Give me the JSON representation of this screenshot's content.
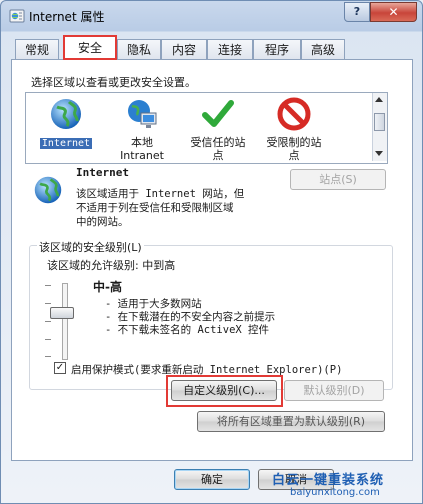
{
  "window": {
    "title": "Internet 属性",
    "help_label": "?",
    "close_label": "✕"
  },
  "tabs": [
    {
      "label": "常规"
    },
    {
      "label": "安全"
    },
    {
      "label": "隐私"
    },
    {
      "label": "内容"
    },
    {
      "label": "连接"
    },
    {
      "label": "程序"
    },
    {
      "label": "高级"
    }
  ],
  "active_tab": "安全",
  "zones_prompt": "选择区域以查看或更改安全设置。",
  "zones": [
    {
      "label": "Internet",
      "icon": "globe-icon",
      "selected": true
    },
    {
      "label": "本地\nIntranet",
      "icon": "local-intranet-icon"
    },
    {
      "label": "受信任的站\n点",
      "icon": "green-check-icon"
    },
    {
      "label": "受限制的站\n点",
      "icon": "no-entry-icon"
    }
  ],
  "zone_info": {
    "name": "Internet",
    "desc_1": "该区域适用于 Internet 网站，但",
    "desc_2": "不适用于列在受信任和受限制区域",
    "desc_3": "中的网站。",
    "sites_button": "站点(S)"
  },
  "security_level": {
    "group_label": "该区域的安全级别(L)",
    "allowed_label": "该区域的允许级别: 中到高",
    "level_name": "中-高",
    "bullets": [
      "- 适用于大多数网站",
      "- 在下载潜在的不安全内容之前提示",
      "- 不下载未签名的 ActiveX 控件"
    ],
    "slider_level": 3
  },
  "protected_mode": {
    "label": "启用保护模式(要求重新启动 Internet Explorer)(P)",
    "checked": true
  },
  "buttons": {
    "custom_level": "自定义级别(C)...",
    "default_level": "默认级别(D)",
    "reset_all": "将所有区域重置为默认级别(R)",
    "ok": "确定",
    "cancel": "取消"
  },
  "watermark": {
    "text_1": "白云一键重装系统",
    "text_2": "baiyunxitong.com"
  },
  "colors": {
    "highlight_red": "#e23a35",
    "selection_blue": "#3b6db5"
  }
}
